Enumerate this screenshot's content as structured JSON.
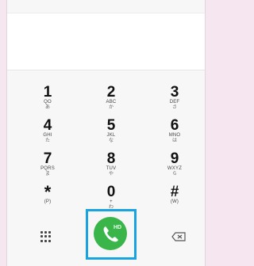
{
  "keypad": [
    {
      "digit": "1",
      "sub1": "QO",
      "sub2": "あ"
    },
    {
      "digit": "2",
      "sub1": "ABC",
      "sub2": "か"
    },
    {
      "digit": "3",
      "sub1": "DEF",
      "sub2": "さ"
    },
    {
      "digit": "4",
      "sub1": "GHI",
      "sub2": "た"
    },
    {
      "digit": "5",
      "sub1": "JKL",
      "sub2": "な"
    },
    {
      "digit": "6",
      "sub1": "MNO",
      "sub2": "は"
    },
    {
      "digit": "7",
      "sub1": "PQRS",
      "sub2": "ま"
    },
    {
      "digit": "8",
      "sub1": "TUV",
      "sub2": "や"
    },
    {
      "digit": "9",
      "sub1": "WXYZ",
      "sub2": "ら"
    },
    {
      "digit": "*",
      "sub1": "(P)",
      "sub2": ""
    },
    {
      "digit": "0",
      "sub1": "+",
      "sub2": "わ"
    },
    {
      "digit": "#",
      "sub1": "(W)",
      "sub2": ""
    }
  ],
  "call_button": {
    "badge": "HD"
  },
  "icons": {
    "dialpad": "dialpad-grid-icon",
    "call": "phone-icon",
    "backspace": "backspace-icon"
  },
  "colors": {
    "call_green": "#39b54a",
    "highlight": "#1aa3e0"
  }
}
